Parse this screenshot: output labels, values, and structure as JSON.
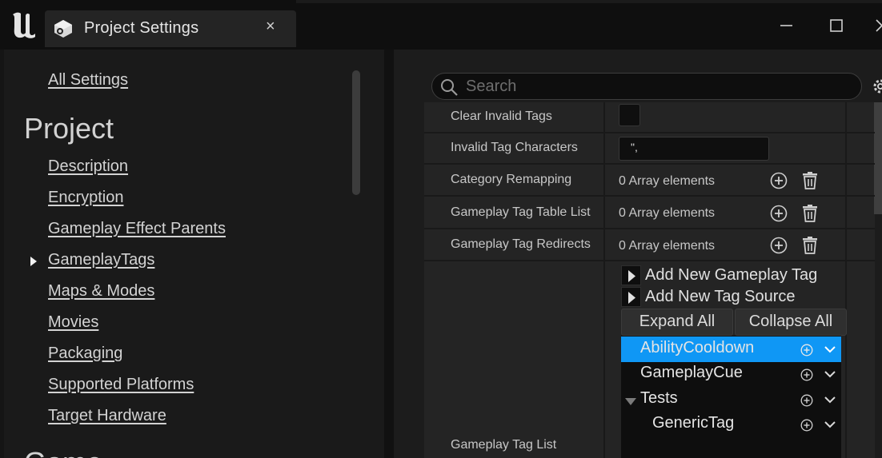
{
  "window": {
    "tab_title": "Project Settings",
    "tab_close": "×",
    "logo": "unreal-logo",
    "controls": [
      "minimize-icon",
      "maximize-icon",
      "close-icon"
    ]
  },
  "sidebar": {
    "all_settings": "All Settings",
    "section_project": "Project",
    "items": [
      {
        "label": "Description"
      },
      {
        "label": "Encryption"
      },
      {
        "label": "Gameplay Effect Parents"
      },
      {
        "label": "GameplayTags",
        "selected": true
      },
      {
        "label": "Maps & Modes"
      },
      {
        "label": "Movies"
      },
      {
        "label": "Packaging"
      },
      {
        "label": "Supported Platforms"
      },
      {
        "label": "Target Hardware"
      }
    ],
    "section_next": "Game"
  },
  "search": {
    "placeholder": "Search",
    "value": ""
  },
  "properties": {
    "clear_invalid_tags": {
      "label": "Clear Invalid Tags",
      "checked": false
    },
    "invalid_tag_characters": {
      "label": "Invalid Tag Characters",
      "value": "\","
    },
    "category_remapping": {
      "label": "Category Remapping",
      "value": "0 Array elements"
    },
    "gameplay_tag_table_list": {
      "label": "Gameplay Tag Table List",
      "value": "0 Array elements"
    },
    "gameplay_tag_redirects": {
      "label": "Gameplay Tag Redirects",
      "value": "0 Array elements"
    },
    "gameplay_tag_list": {
      "label": "Gameplay Tag List"
    }
  },
  "tag_editor": {
    "add_new_tag": "Add New Gameplay Tag",
    "add_new_source": "Add New Tag Source",
    "expand_all": "Expand All",
    "collapse_all": "Collapse All",
    "tags": [
      {
        "name": "AbilityCooldown",
        "selected": true
      },
      {
        "name": "GameplayCue"
      },
      {
        "name": "Tests",
        "expanded": true
      },
      {
        "name": "GenericTag",
        "indent": 1
      }
    ]
  },
  "colors": {
    "selection": "#0f97f5",
    "background": "#151515",
    "panel": "#242424"
  }
}
